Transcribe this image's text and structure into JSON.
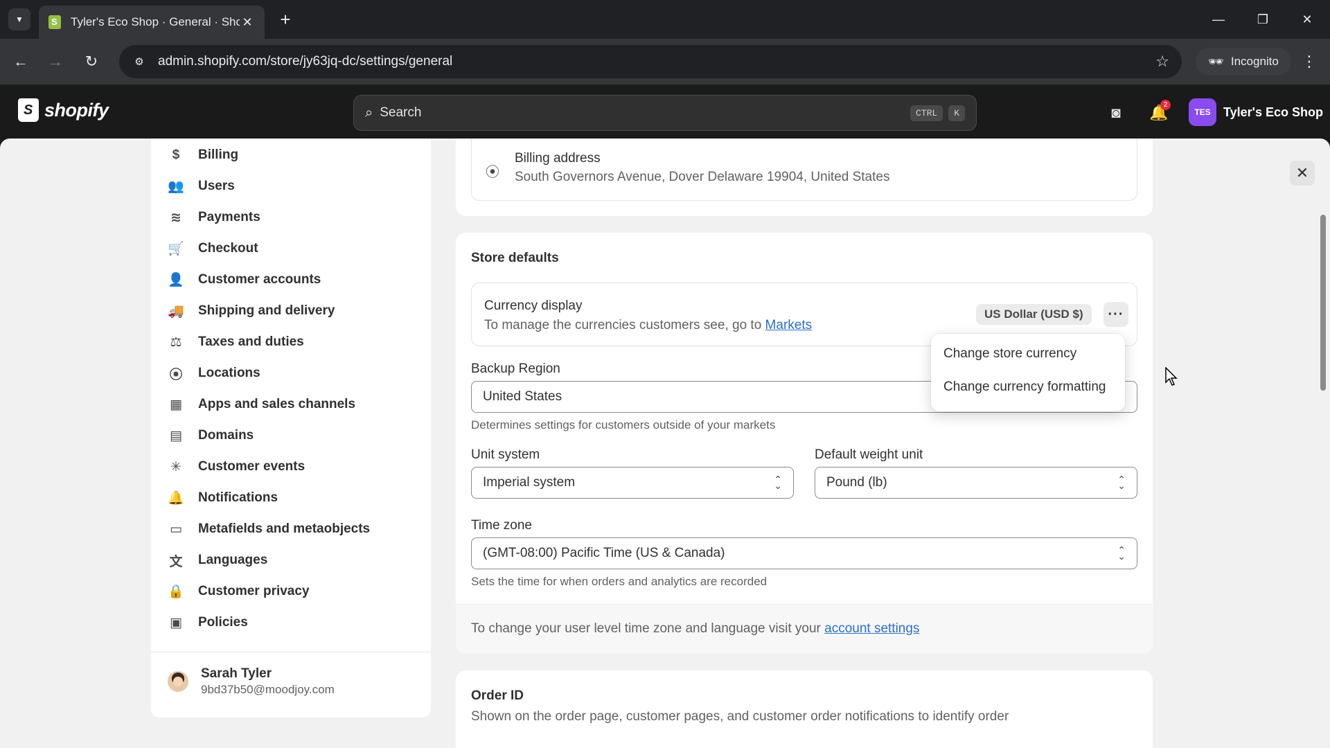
{
  "browser": {
    "tab_title": "Tyler's Eco Shop · General · Sho",
    "url": "admin.shopify.com/store/jy63jq-dc/settings/general",
    "incognito_label": "Incognito"
  },
  "topbar": {
    "logo_text": "shopify",
    "search_placeholder": "Search",
    "shortcut_ctrl": "CTRL",
    "shortcut_k": "K",
    "notification_count": "2",
    "store_initials": "TES",
    "store_name": "Tyler's Eco Shop"
  },
  "sidebar": {
    "items": [
      {
        "label": "Billing",
        "icon": "billing-icon"
      },
      {
        "label": "Users",
        "icon": "users-icon"
      },
      {
        "label": "Payments",
        "icon": "payments-icon"
      },
      {
        "label": "Checkout",
        "icon": "cart-icon"
      },
      {
        "label": "Customer accounts",
        "icon": "person-icon"
      },
      {
        "label": "Shipping and delivery",
        "icon": "truck-icon"
      },
      {
        "label": "Taxes and duties",
        "icon": "tax-icon"
      },
      {
        "label": "Locations",
        "icon": "location-icon"
      },
      {
        "label": "Apps and sales channels",
        "icon": "apps-icon"
      },
      {
        "label": "Domains",
        "icon": "domains-icon"
      },
      {
        "label": "Customer events",
        "icon": "sparkle-icon"
      },
      {
        "label": "Notifications",
        "icon": "bell-icon"
      },
      {
        "label": "Metafields and metaobjects",
        "icon": "metafields-icon"
      },
      {
        "label": "Languages",
        "icon": "language-icon"
      },
      {
        "label": "Customer privacy",
        "icon": "lock-icon"
      },
      {
        "label": "Policies",
        "icon": "policies-icon"
      }
    ],
    "user": {
      "name": "Sarah Tyler",
      "email": "9bd37b50@moodjoy.com"
    }
  },
  "billing": {
    "title": "Billing address",
    "address": "South Governors Avenue, Dover Delaware 19904, United States"
  },
  "store_defaults": {
    "title": "Store defaults",
    "currency": {
      "title": "Currency display",
      "subtitle_prefix": "To manage the currencies customers see, go to ",
      "markets_link": "Markets",
      "badge": "US Dollar (USD $)"
    },
    "backup_region": {
      "label": "Backup Region",
      "value": "United States",
      "help": "Determines settings for customers outside of your markets"
    },
    "unit_system": {
      "label": "Unit system",
      "value": "Imperial system"
    },
    "weight_unit": {
      "label": "Default weight unit",
      "value": "Pound (lb)"
    },
    "time_zone": {
      "label": "Time zone",
      "value": "(GMT-08:00) Pacific Time (US & Canada)",
      "help": "Sets the time for when orders and analytics are recorded"
    },
    "footer_prefix": "To change your user level time zone and language visit your ",
    "footer_link": "account settings"
  },
  "currency_menu": {
    "items": [
      "Change store currency",
      "Change currency formatting"
    ]
  },
  "order_id": {
    "title": "Order ID",
    "subtitle": "Shown on the order page, customer pages, and customer order notifications to identify order"
  }
}
